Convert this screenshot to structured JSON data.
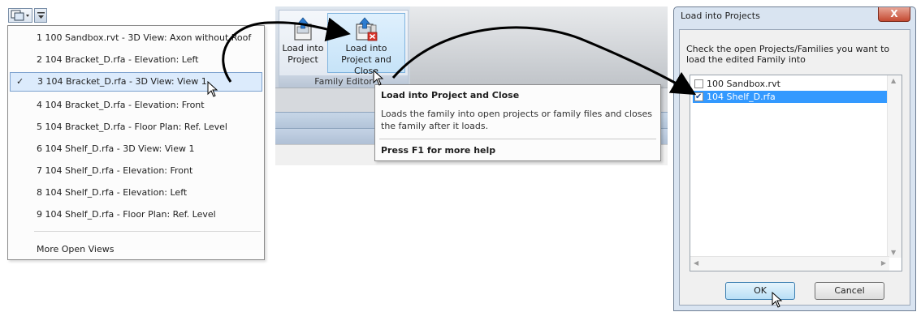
{
  "switch_menu": {
    "items": [
      {
        "label": "1 100 Sandbox.rvt - 3D View: Axon without Roof",
        "selected": false
      },
      {
        "label": "2 104 Bracket_D.rfa - Elevation: Left",
        "selected": false
      },
      {
        "label": "3 104 Bracket_D.rfa - 3D View: View 1",
        "selected": true
      },
      {
        "label": "4 104 Bracket_D.rfa - Elevation: Front",
        "selected": false
      },
      {
        "label": "5 104 Bracket_D.rfa - Floor Plan: Ref. Level",
        "selected": false
      },
      {
        "label": "6 104 Shelf_D.rfa - 3D View: View 1",
        "selected": false
      },
      {
        "label": "7 104 Shelf_D.rfa - Elevation: Front",
        "selected": false
      },
      {
        "label": "8 104 Shelf_D.rfa - Elevation: Left",
        "selected": false
      },
      {
        "label": "9 104 Shelf_D.rfa - Floor Plan: Ref. Level",
        "selected": false
      }
    ],
    "check_mark": "✓",
    "more": "More Open Views"
  },
  "ribbon": {
    "load_into_project": "Load into Project",
    "load_into_project_lines": [
      "Load into",
      "Project"
    ],
    "load_into_project_close_lines": [
      "Load into",
      "Project and Close"
    ],
    "panel_title": "Family Editor"
  },
  "tooltip": {
    "title": "Load into Project and Close",
    "description": "Loads the family into open projects or family files and closes the family after it loads.",
    "help": "Press F1 for more help"
  },
  "dialog": {
    "title": "Load into Projects",
    "close": "X",
    "instructions": "Check the open Projects/Families you want to load the edited Family into",
    "items": [
      {
        "label": "100 Sandbox.rvt",
        "checked": false,
        "highlighted": false
      },
      {
        "label": "104 Shelf_D.rfa",
        "checked": true,
        "highlighted": true
      }
    ],
    "ok": "OK",
    "cancel": "Cancel"
  },
  "colors": {
    "accent": "#3399ff",
    "selection": "#dcebfc",
    "close_button": "#c44a31"
  }
}
